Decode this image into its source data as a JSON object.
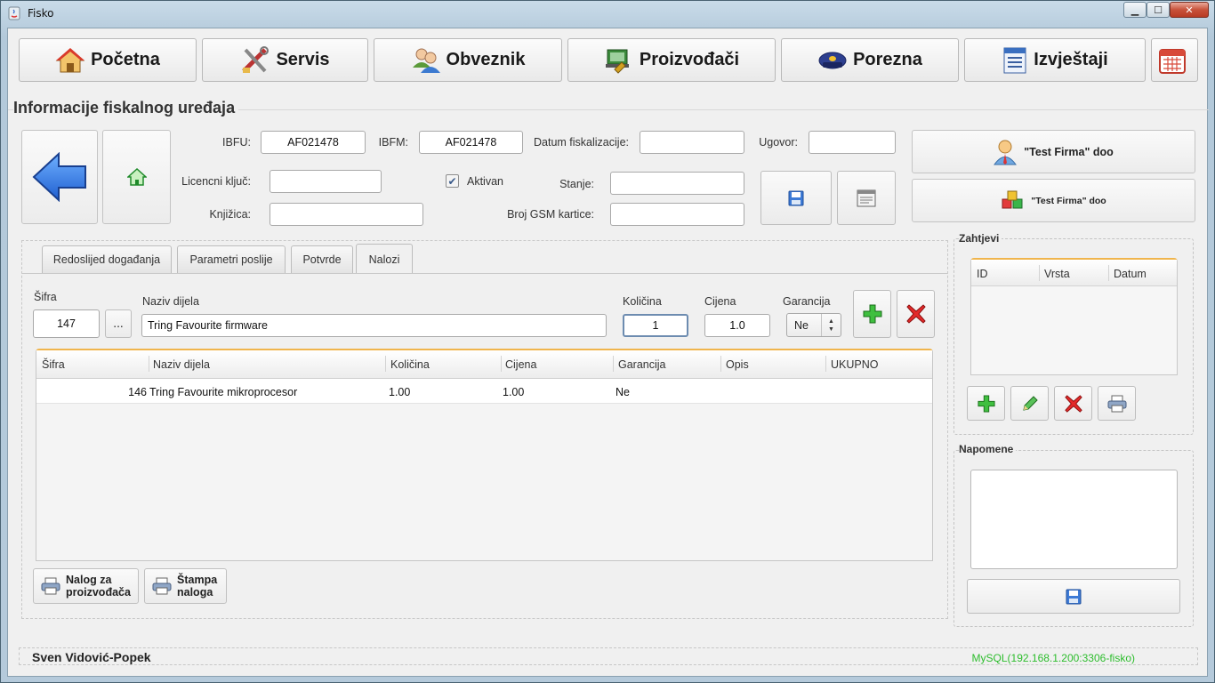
{
  "window": {
    "title": "Fisko"
  },
  "nav": {
    "pocetna": "Početna",
    "servis": "Servis",
    "obveznik": "Obveznik",
    "proizvodaci": "Proizvođači",
    "porezna": "Porezna",
    "izvjestaji": "Izvještaji"
  },
  "section": {
    "title": "Informacije fiskalnog uređaja"
  },
  "device": {
    "ibfu_label": "IBFU:",
    "ibfu_value": "AF021478",
    "ibfm_label": "IBFM:",
    "ibfm_value": "AF021478",
    "datum_label": "Datum fiskalizacije:",
    "datum_value": "",
    "ugovor_label": "Ugovor:",
    "ugovor_value": "",
    "licencni_label": "Licencni ključ:",
    "licencni_value": "",
    "aktivan_label": "Aktivan",
    "aktivan_checked": true,
    "stanje_label": "Stanje:",
    "stanje_value": "",
    "knjizica_label": "Knjižica:",
    "knjizica_value": "",
    "gsm_label": "Broj GSM kartice:",
    "gsm_value": ""
  },
  "firm": {
    "button1": "\"Test Firma\" doo",
    "button2": "\"Test Firma\" doo"
  },
  "tabs": [
    {
      "label": "Redoslijed događanja"
    },
    {
      "label": "Parametri poslije"
    },
    {
      "label": "Potvrde"
    },
    {
      "label": "Nalozi"
    }
  ],
  "entry": {
    "sifra_label": "Šifra",
    "sifra_value": "147",
    "browse_label": "...",
    "naziv_label": "Naziv dijela",
    "naziv_value": "Tring Favourite firmware",
    "kolicina_label": "Količina",
    "kolicina_value": "1",
    "cijena_label": "Cijena",
    "cijena_value": "1.0",
    "garancija_label": "Garancija",
    "garancija_value": "Ne"
  },
  "table": {
    "columns": [
      "Šifra",
      "Naziv dijela",
      "Količina",
      "Cijena",
      "Garancija",
      "Opis",
      "UKUPNO"
    ],
    "rows": [
      {
        "sifra": "146",
        "naziv": "Tring Favourite mikroprocesor",
        "kolicina": "1.00",
        "cijena": "1.00",
        "garancija": "Ne",
        "opis": "",
        "ukupno": ""
      }
    ]
  },
  "buttons": {
    "nalog_line1": "Nalog za",
    "nalog_line2": "proizvođača",
    "stampa_line1": "Štampa",
    "stampa_line2": "naloga"
  },
  "zahtjevi": {
    "title": "Zahtjevi",
    "columns": [
      "ID",
      "Vrsta",
      "Datum"
    ]
  },
  "napomene": {
    "title": "Napomene",
    "value": ""
  },
  "status": {
    "user": "Sven Vidović-Popek",
    "db": "MySQL(192.168.1.200:3306-fisko)"
  }
}
